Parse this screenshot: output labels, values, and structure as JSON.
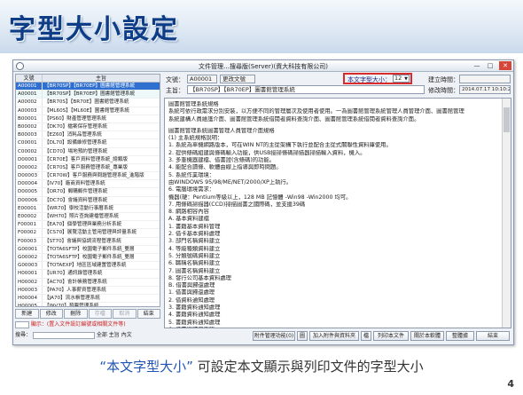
{
  "slide": {
    "title": "字型大小設定",
    "caption_quote": "“本文字型大小”",
    "caption_text": "可設定本文顯示與列印文件的字型大小",
    "page_number": "4"
  },
  "window": {
    "title": "文件管理…搜尋版(Server)(資大科技有限公司)",
    "controls": {
      "min": "—",
      "max": "□",
      "close": "✕"
    }
  },
  "list": {
    "headers": [
      "文號",
      "主旨"
    ],
    "rows": [
      {
        "code": "A00001",
        "title": "【BR70SP】【BR70EP】圖書館管理系統"
      },
      {
        "code": "A00001",
        "title": "【BR70SP】【BR70EP】圖書館管理系統"
      },
      {
        "code": "A00002",
        "title": "【BR70S】【BR70E】圖書館管理系統"
      },
      {
        "code": "A00003",
        "title": "【ML60S】【ML60E】圖書館管理系統"
      },
      {
        "code": "B00001",
        "title": "【PS60】財產管理管理系統"
      },
      {
        "code": "B00002",
        "title": "【DK70】檔案保存管理系統"
      },
      {
        "code": "B00003",
        "title": "【EZ60】消耗品管理系統"
      },
      {
        "code": "C00001",
        "title": "【DL70】設備維修管理系統"
      },
      {
        "code": "C00002",
        "title": "【CD70】場地預約管理系統"
      },
      {
        "code": "D00001",
        "title": "【CR70E】客戶資料管理系統_總類版"
      },
      {
        "code": "D00002",
        "title": "【CR70S】客戶服務管理系統_專業版"
      },
      {
        "code": "D00003",
        "title": "【CR70W】客戶服務與問題管理系統_進階版"
      },
      {
        "code": "D00004",
        "title": "【IV70】廠商資料管理系統"
      },
      {
        "code": "D00005",
        "title": "【OR70】郵購郵件管理系統"
      },
      {
        "code": "D00006",
        "title": "【DC70】會議資料管理系統"
      },
      {
        "code": "E00001",
        "title": "【WR70】學校活動行事曆系統"
      },
      {
        "code": "E00002",
        "title": "【WH70】照片查詢建檔管理系統"
      },
      {
        "code": "F00001",
        "title": "【EA70】個學管理與業務分析系統"
      },
      {
        "code": "F00002",
        "title": "【CS70】展覽活動主管用管理與評量系統"
      },
      {
        "code": "F00003",
        "title": "【ST70】會議與協調流程管理系統"
      },
      {
        "code": "G00001",
        "title": "【TOTA6SFTP】校園電子郵件系統_雙層"
      },
      {
        "code": "G00002",
        "title": "【TOTA6SFTP】校園電子郵件系統_雙層"
      },
      {
        "code": "G00003",
        "title": "【TOTAEXP】地區區域建置管理系統"
      },
      {
        "code": "H00001",
        "title": "【UR70】通訊錄管理系統"
      },
      {
        "code": "H00002",
        "title": "【AC70】會計帳務管理系統"
      },
      {
        "code": "H00003",
        "title": "【PA70】人事薪資管理系統"
      },
      {
        "code": "H00004",
        "title": "【JA70】流水帳管理系統"
      },
      {
        "code": "H00005",
        "title": "【INV70】發票管理系統"
      },
      {
        "code": "H00006",
        "title": "【BC60】名片管理管理系統"
      }
    ],
    "buttons": [
      "新建",
      "修改",
      "刪除",
      "存檔",
      "取消",
      "結束"
    ],
    "row2": "顯示：(置入文件設訂編號或相關文件等)",
    "row3_label": "搜尋：",
    "row3_opts": [
      "全部",
      "主旨",
      "內文"
    ]
  },
  "form": {
    "docno_label": "文號：",
    "docno_value": "A00001",
    "docno_tag": "更改文號",
    "font_label": "本文字型大小：",
    "font_size": "12",
    "created_label": "建立時間：",
    "created_value": "",
    "modified_label": "修改時間：",
    "modified_value": "2014.07.17 10:10:22",
    "subject_label": "主旨：",
    "subject_value": "【BR70SP】【BR70EP】圖書館管理系統"
  },
  "document": {
    "lines": [
      "圖書館管理系統規格",
      "系統可依行政需求分別安裝，以方便不同的管理層次及使用者使用。一為圖書館管理系統管理人員管理介面、圖書館管理",
      "系統建構人員維護介面、圖書館管理系統借閱者資料查詢介面、圖書館管理系統借閱者資料查詢介面。",
      "",
      "圖書館管理系統圖書管理人員管理介面規格",
      "(1) 主系統規格說明：",
      "  1. 系統為單機網路版本，可在WIN NT的主從架構下執行並配合主從式關聯性資料庫使用。",
      "  2. 提供條碼組建與條碼輸入功能，供USB接掃條碼掃描器掃描輸入資料，機入。",
      "  3. 多重機器建檔、借書證(含條碼)的功能。",
      "  4. 能配合讀條、軟體由線上指導與即時問題。",
      "  5. 系統作業環境：",
      "     由WINDOWS 95/98/ME/NET/2000/XP上執行。",
      "  6. 電腦環境需求：",
      "     機器(硬：Pentium等級以上，128 MB 記憶體 -Win98 -Win2000 均可。",
      "  7. 用條碼掃描器(CCD)掃描圖書之國際碼，並支援39碼",
      "  8. 網路相容內容",
      "  A. 基本資料建檔",
      "  1. 書籍基本資料管理",
      "  2. 借卡基本資料處理",
      "  3. 部門名稱資料建立",
      "  4. 等級種類資料建立",
      "  5. 分類號碼資料建立",
      "  6. 職稱名稱資料建立",
      "  7. 圖書名稱資料建立",
      "  8. 發行公司基本資料處理",
      "  B. 借書與歸還處理",
      "  1. 借書與歸還處理",
      "  2. 借資料通知處理",
      "  3. 書籍資料通知處理",
      "  4. 書籍資料通知處理",
      "  5. 書籍資料通知處理",
      "  6. 借書與歸還查詢"
    ]
  },
  "toolbar": {
    "buttons": [
      "附件管理功能(0)",
      "圖",
      "加入附件與資料夾",
      "檔",
      "列印本文件",
      "關於本軟體",
      "整體據",
      "結束"
    ]
  }
}
